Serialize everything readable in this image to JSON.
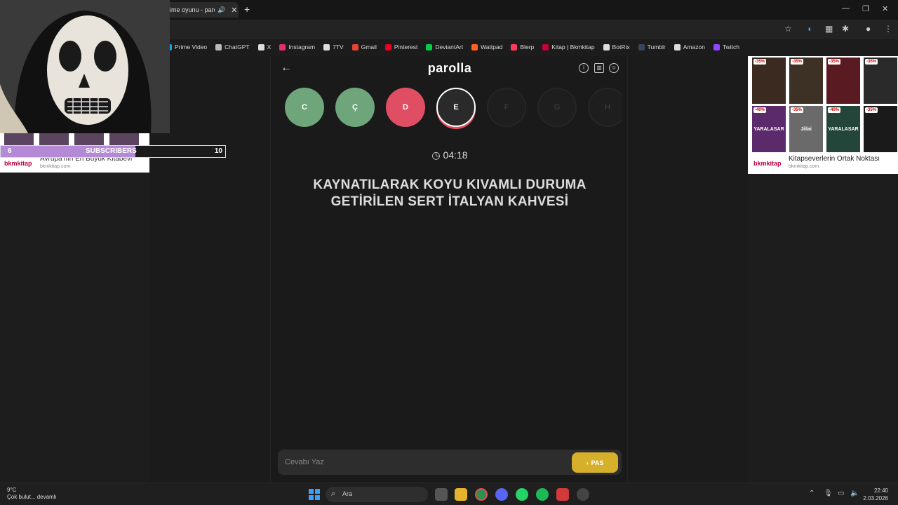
{
  "browser": {
    "tab_title": "ime oyunu - parc",
    "tab_audio": "🔊",
    "tab_close": "✕",
    "new_tab": "+",
    "window_controls": {
      "min": "—",
      "max": "❐",
      "close": "✕"
    },
    "bookmarks": [
      {
        "label": "Prime Video",
        "color": "#1aa3e8"
      },
      {
        "label": "ChatGPT",
        "color": "#bbbbbb"
      },
      {
        "label": "X",
        "color": "#dddddd"
      },
      {
        "label": "Instagram",
        "color": "#e1306c"
      },
      {
        "label": "7TV",
        "color": "#dddddd"
      },
      {
        "label": "Gmail",
        "color": "#ea4335"
      },
      {
        "label": "Pinterest",
        "color": "#e60023"
      },
      {
        "label": "DeviantArt",
        "color": "#05cc47"
      },
      {
        "label": "Wattpad",
        "color": "#ff6122"
      },
      {
        "label": "Blerp",
        "color": "#ff3a5c"
      },
      {
        "label": "Kitap | Bkmkitap",
        "color": "#c7003a"
      },
      {
        "label": "BotRix",
        "color": "#dddddd"
      },
      {
        "label": "Tumblr",
        "color": "#36465d"
      },
      {
        "label": "Amazon",
        "color": "#dddddd"
      },
      {
        "label": "Twitch",
        "color": "#9146ff"
      }
    ]
  },
  "game": {
    "back_icon": "←",
    "logo": "parolla",
    "header_icons": {
      "info": "i",
      "stats": "▥",
      "profile": "☺"
    },
    "letters": [
      {
        "char": "C",
        "state": "correct",
        "color": "#6fa57a"
      },
      {
        "char": "Ç",
        "state": "correct",
        "color": "#6fa57a"
      },
      {
        "char": "D",
        "state": "wrong",
        "color": "#e04e63"
      },
      {
        "char": "E",
        "state": "active",
        "color": "#2a2a2a"
      },
      {
        "char": "F",
        "state": "pending",
        "color": "#1e1e1e"
      },
      {
        "char": "G",
        "state": "pending",
        "color": "#1e1e1e"
      },
      {
        "char": "H",
        "state": "pending",
        "color": "#1e1e1e"
      }
    ],
    "timer": "04:18",
    "question": "KAYNATILARAK KOYU KIVAMLI DURUMA GETİRİLEN SERT İTALYAN KAHVESİ",
    "answer_placeholder": "Cevabı Yaz",
    "pass_label": "PAS",
    "pass_icon": "›",
    "accent": "#d6b02a"
  },
  "overlay": {
    "subs_current": "6",
    "subs_label": "SUBSCRIBERS",
    "subs_goal": "10",
    "subs_fraction": 0.6
  },
  "ads": {
    "left_logo": "bkmkitap",
    "left_text": "Avrupa'nın En Büyük Kitabevi",
    "left_domain": "bkmkitap.com",
    "right_logo": "bkmkitap",
    "right_text": "Kitapseverlerin Ortak Noktası",
    "right_domain": "bkmkitap.com",
    "books": [
      {
        "discount": "-35%",
        "color": "#3a2a20"
      },
      {
        "discount": "-35%",
        "color": "#3d3126"
      },
      {
        "discount": "-35%",
        "color": "#5a1a22"
      },
      {
        "discount": "-35%",
        "color": "#2a2a2a"
      },
      {
        "discount": "-40%",
        "color": "#5a2a6a",
        "title": "YARALASAR"
      },
      {
        "discount": "-35%",
        "color": "#6a6a6a",
        "title": "Jillai"
      },
      {
        "discount": "-40%",
        "color": "#24453a",
        "title": "YARALASAR"
      },
      {
        "discount": "-35%",
        "color": "#1a1a1a"
      }
    ]
  },
  "taskbar": {
    "weather_temp": "9°C",
    "weather_desc": "Çok bulut... devamlı",
    "search_label": "Ara",
    "time": "22:40",
    "date": "2.03.2026"
  }
}
